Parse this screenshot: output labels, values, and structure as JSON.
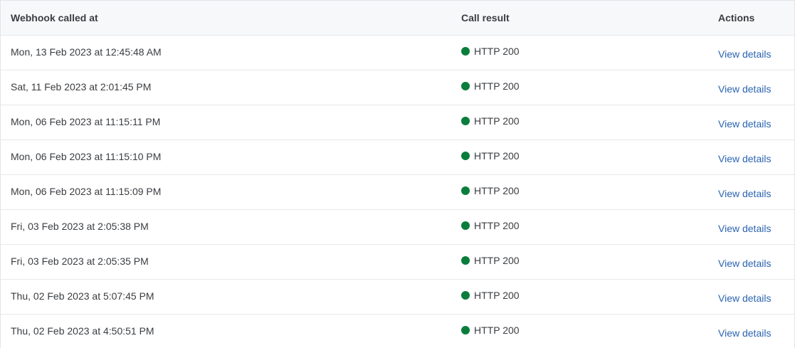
{
  "table": {
    "headers": {
      "called_at": "Webhook called at",
      "call_result": "Call result",
      "actions": "Actions"
    },
    "status_color": "#0a7d3c",
    "link_color": "#2b64b0",
    "rows": [
      {
        "called_at": "Mon, 13 Feb 2023 at 12:45:48 AM",
        "result": "HTTP 200",
        "action": "View details"
      },
      {
        "called_at": "Sat, 11 Feb 2023 at 2:01:45 PM",
        "result": "HTTP 200",
        "action": "View details"
      },
      {
        "called_at": "Mon, 06 Feb 2023 at 11:15:11 PM",
        "result": "HTTP 200",
        "action": "View details"
      },
      {
        "called_at": "Mon, 06 Feb 2023 at 11:15:10 PM",
        "result": "HTTP 200",
        "action": "View details"
      },
      {
        "called_at": "Mon, 06 Feb 2023 at 11:15:09 PM",
        "result": "HTTP 200",
        "action": "View details"
      },
      {
        "called_at": "Fri, 03 Feb 2023 at 2:05:38 PM",
        "result": "HTTP 200",
        "action": "View details"
      },
      {
        "called_at": "Fri, 03 Feb 2023 at 2:05:35 PM",
        "result": "HTTP 200",
        "action": "View details"
      },
      {
        "called_at": "Thu, 02 Feb 2023 at 5:07:45 PM",
        "result": "HTTP 200",
        "action": "View details"
      },
      {
        "called_at": "Thu, 02 Feb 2023 at 4:50:51 PM",
        "result": "HTTP 200",
        "action": "View details"
      }
    ]
  }
}
